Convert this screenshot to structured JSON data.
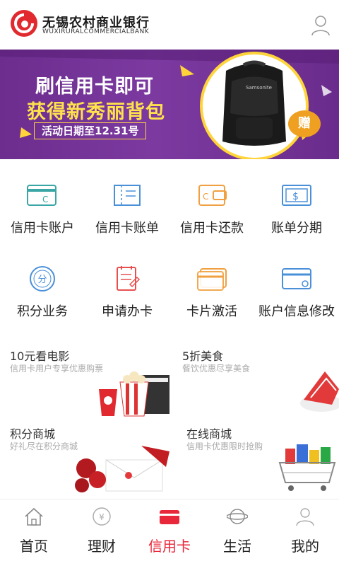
{
  "header": {
    "brand_cn": "无锡农村商业银行",
    "brand_en": "WUXIRURALCOMMERCIALBANK"
  },
  "banner": {
    "line1": "刷信用卡即可",
    "line2": "获得新秀丽背包",
    "date": "活动日期至12.31号",
    "gift": "赠",
    "bag_brand": "Samsonite",
    "slide_count": 4,
    "active_slide": 1
  },
  "services": [
    {
      "label": "信用卡账户",
      "icon": "card-account-icon"
    },
    {
      "label": "信用卡账单",
      "icon": "card-bill-icon"
    },
    {
      "label": "信用卡还款",
      "icon": "card-repay-icon"
    },
    {
      "label": "账单分期",
      "icon": "installment-icon"
    },
    {
      "label": "积分业务",
      "icon": "points-icon"
    },
    {
      "label": "申请办卡",
      "icon": "apply-card-icon"
    },
    {
      "label": "卡片激活",
      "icon": "card-activate-icon"
    },
    {
      "label": "账户信息修改",
      "icon": "account-edit-icon"
    }
  ],
  "points_badge": "分",
  "promos": [
    {
      "title": "10元看电影",
      "subtitle": "信用卡用户专享优惠购票"
    },
    {
      "title": "5折美食",
      "subtitle": "餐饮优惠尽享美食"
    },
    {
      "title": "积分商城",
      "subtitle": "好礼尽在积分商城"
    },
    {
      "title": "在线商城",
      "subtitle": "信用卡优惠限时抢购"
    }
  ],
  "tabs": [
    {
      "label": "首页",
      "icon": "home-icon"
    },
    {
      "label": "理财",
      "icon": "finance-icon"
    },
    {
      "label": "信用卡",
      "icon": "credit-card-icon"
    },
    {
      "label": "生活",
      "icon": "life-icon"
    },
    {
      "label": "我的",
      "icon": "profile-icon"
    }
  ],
  "active_tab": "信用卡",
  "colors": {
    "accent_red": "#e8273a",
    "banner_purple": "#6c2d8e",
    "icon_teal": "#3aa6a6",
    "icon_blue": "#4a90d9",
    "icon_orange": "#f0a040",
    "icon_red": "#e85050"
  }
}
